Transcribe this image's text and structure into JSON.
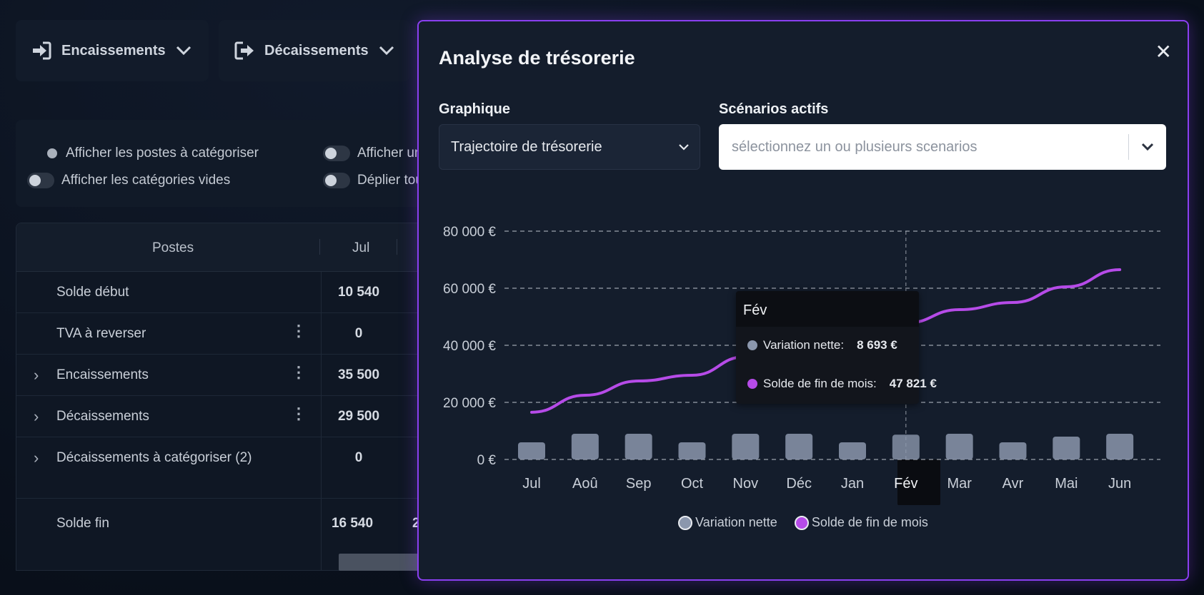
{
  "toolbar": {
    "encaissements": "Encaissements",
    "decaissements": "Décaissements"
  },
  "options": {
    "postes_a_categoriser": "Afficher les postes à catégoriser",
    "categories_vides": "Afficher les catégories vides",
    "afficher_un": "Afficher un",
    "deplier_tout": "Déplier tou"
  },
  "table": {
    "header_postes": "Postes",
    "header_month": "Jul",
    "rows": [
      {
        "label": "Solde début",
        "value": "10 540"
      },
      {
        "label": "TVA à reverser",
        "value": "0"
      },
      {
        "label": "Encaissements",
        "value": "35 500"
      },
      {
        "label": "Décaissements",
        "value": "29 500"
      },
      {
        "label": "Décaissements à catégoriser (2)",
        "value": "0"
      }
    ],
    "footer_label": "Solde fin",
    "footer_value": "16 540",
    "footer_partial": "2"
  },
  "modal": {
    "title": "Analyse de trésorerie",
    "graph_label": "Graphique",
    "graph_value": "Trajectoire de trésorerie",
    "scenarios_label": "Scénarios actifs",
    "scenarios_placeholder": "sélectionnez un ou plusieurs scenarios"
  },
  "tooltip": {
    "month": "Fév",
    "variation_label": "Variation nette:",
    "variation_value": "8 693 €",
    "solde_label": "Solde de fin de mois:",
    "solde_value": "47 821 €"
  },
  "colors": {
    "accent": "#8a3ff0",
    "line": "#b64be8",
    "bar": "#8b97ad"
  },
  "chart_data": {
    "type": "bar+line",
    "categories": [
      "Jul",
      "Aoû",
      "Sep",
      "Oct",
      "Nov",
      "Déc",
      "Jan",
      "Fév",
      "Mar",
      "Avr",
      "Mai",
      "Jun"
    ],
    "series": [
      {
        "name": "Variation nette",
        "type": "bar",
        "values": [
          6000,
          9000,
          9000,
          6000,
          9000,
          9000,
          6000,
          8693,
          9000,
          6000,
          8000,
          9000
        ]
      },
      {
        "name": "Solde de fin de mois",
        "type": "line",
        "values": [
          16540,
          22500,
          27500,
          29500,
          36000,
          39500,
          42000,
          47821,
          52500,
          55000,
          60500,
          66500
        ]
      }
    ],
    "yticks": [
      "0 €",
      "20 000 €",
      "40 000 €",
      "60 000 €",
      "80 000 €"
    ],
    "ylim": [
      0,
      80000
    ],
    "grid": true,
    "legend": "bottom",
    "highlighted": "Fév"
  }
}
